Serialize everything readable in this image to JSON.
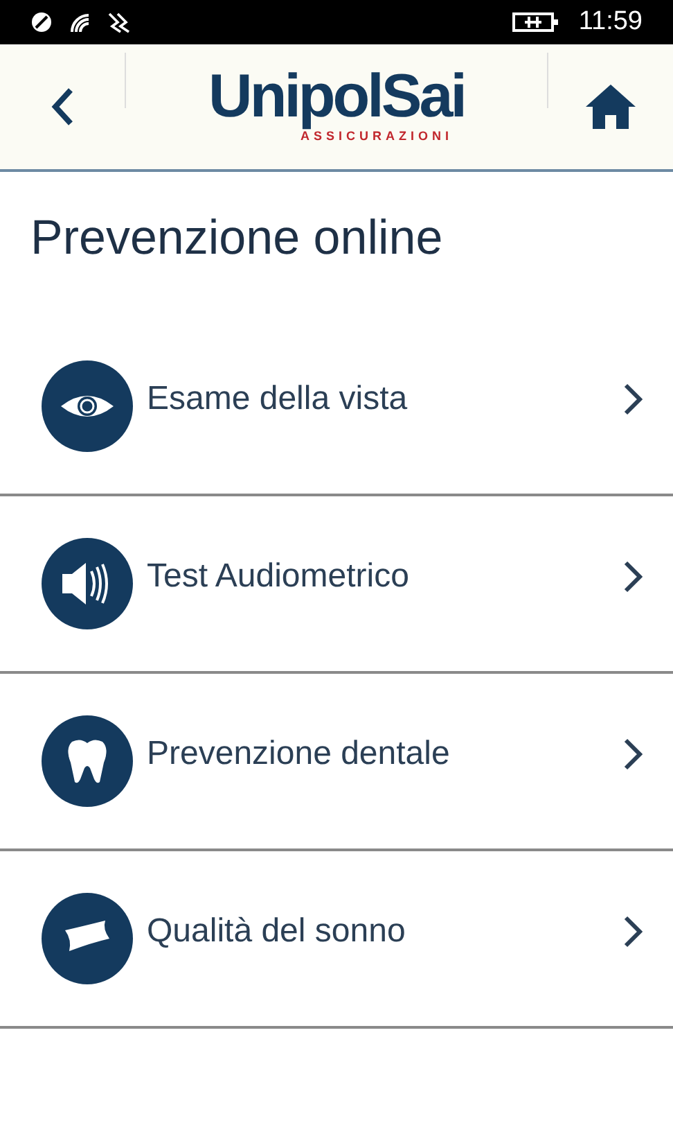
{
  "status_bar": {
    "time": "11:59"
  },
  "header": {
    "logo": {
      "name": "UnipolSai",
      "tagline": "ASSICURAZIONI"
    }
  },
  "title": "Prevenzione online",
  "items": [
    {
      "kind": "eye",
      "label": "Esame della vista"
    },
    {
      "kind": "speaker",
      "label": "Test Audiometrico"
    },
    {
      "kind": "tooth",
      "label": "Prevenzione dentale"
    },
    {
      "kind": "pillow",
      "label": "Qualità del sonno"
    }
  ]
}
